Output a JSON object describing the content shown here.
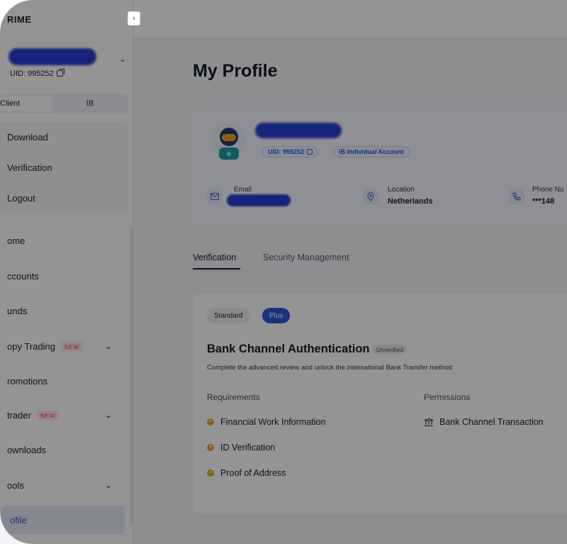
{
  "sidebar": {
    "brand": "RIME",
    "collapse_icon": "chevron-left-icon",
    "user": {
      "uid_label": "UID: 995252"
    },
    "roles": {
      "client": "Client",
      "ib": "IB"
    },
    "user_menu": [
      {
        "label": "Download"
      },
      {
        "label": "Verification"
      },
      {
        "label": "Logout"
      }
    ],
    "nav": [
      {
        "label": "ome"
      },
      {
        "label": "ccounts"
      },
      {
        "label": "unds"
      },
      {
        "label": "opy Trading",
        "badge": "NEW"
      },
      {
        "label": "romotions"
      },
      {
        "label": "trader",
        "badge": "NEW"
      },
      {
        "label": "ownloads"
      },
      {
        "label": "ools"
      },
      {
        "label": "ofile"
      }
    ]
  },
  "main": {
    "title": "My Profile",
    "profile": {
      "uid_chip": "UID: 995252",
      "account_chip": "IB Individual Account",
      "email_label": "Email",
      "location_label": "Location",
      "location_value": "Netherlands",
      "phone_label": "Phone Nu",
      "phone_value": "***148"
    },
    "tabs": [
      {
        "label": "Verification"
      },
      {
        "label": "Security Management"
      }
    ],
    "verification": {
      "levels": [
        "Standard",
        "Plus"
      ],
      "title": "Bank Channel Authentication",
      "status": "Unverified",
      "description": "Complete the advanced review and unlock the International Bank Transfer method",
      "requirements_label": "Requirements",
      "permissions_label": "Permissions",
      "requirements": [
        "Financial Work Information",
        "ID Verification",
        "Proof of Address"
      ],
      "permissions": [
        "Bank Channel Transaction"
      ]
    }
  },
  "colors": {
    "accent": "#2f59d8",
    "pending": "#f0a81c",
    "new_badge": "#e0453a"
  }
}
